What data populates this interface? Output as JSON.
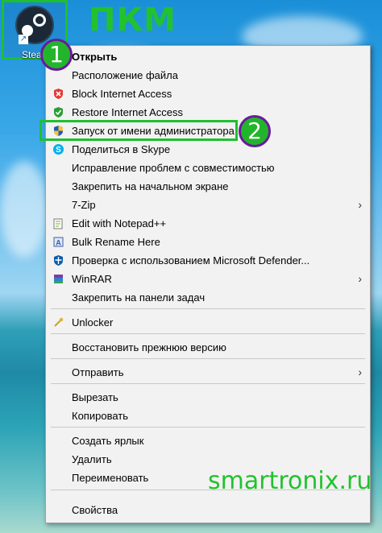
{
  "desktop": {
    "icon_label": "Steam",
    "heading": "ПКМ",
    "watermark": "smartronix.ru"
  },
  "badges": {
    "first": "1",
    "second": "2"
  },
  "menu": {
    "items": [
      {
        "label": "Открыть",
        "icon": "none",
        "bold": true,
        "arrow": false
      },
      {
        "label": "Расположение файла",
        "icon": "none",
        "arrow": false
      },
      {
        "label": "Block Internet Access",
        "icon": "shield-x-icon",
        "arrow": false
      },
      {
        "label": "Restore Internet Access",
        "icon": "shield-check-icon",
        "arrow": false
      },
      {
        "label": "Запуск от имени администратора",
        "icon": "uac-shield-icon",
        "arrow": false
      },
      {
        "label": "Поделиться в Skype",
        "icon": "skype-icon",
        "arrow": false
      },
      {
        "label": "Исправление проблем с совместимостью",
        "icon": "none",
        "arrow": false
      },
      {
        "label": "Закрепить на начальном экране",
        "icon": "none",
        "arrow": false
      },
      {
        "label": "7-Zip",
        "icon": "none",
        "arrow": true
      },
      {
        "label": "Edit with Notepad++",
        "icon": "notepadpp-icon",
        "arrow": false
      },
      {
        "label": "Bulk Rename Here",
        "icon": "bulk-rename-icon",
        "arrow": false
      },
      {
        "label": "Проверка с использованием Microsoft Defender...",
        "icon": "defender-icon",
        "arrow": false
      },
      {
        "label": "WinRAR",
        "icon": "winrar-icon",
        "arrow": true
      },
      {
        "label": "Закрепить на панели задач",
        "icon": "none",
        "arrow": false
      },
      {
        "label": "Unlocker",
        "icon": "unlocker-icon",
        "arrow": false
      },
      {
        "label": "Восстановить прежнюю версию",
        "icon": "none",
        "arrow": false
      },
      {
        "label": "Отправить",
        "icon": "none",
        "arrow": true
      },
      {
        "label": "Вырезать",
        "icon": "none",
        "arrow": false
      },
      {
        "label": "Копировать",
        "icon": "none",
        "arrow": false
      },
      {
        "label": "Создать ярлык",
        "icon": "none",
        "arrow": false
      },
      {
        "label": "Удалить",
        "icon": "none",
        "arrow": false
      },
      {
        "label": "Переименовать",
        "icon": "none",
        "arrow": false
      },
      {
        "label": "Свойства",
        "icon": "none",
        "arrow": false
      }
    ],
    "submenu_arrow": "›"
  }
}
